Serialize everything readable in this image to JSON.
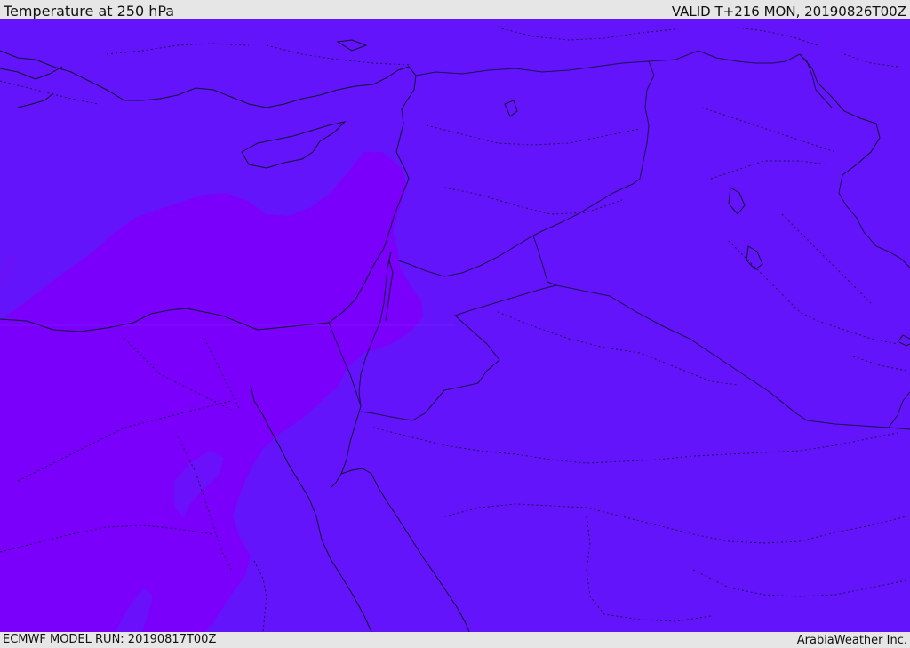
{
  "header": {
    "title": "Temperature at 250 hPa",
    "valid": "VALID T+216 MON, 20190826T00Z"
  },
  "footer": {
    "model_run": "ECMWF MODEL RUN: 20190817T00Z",
    "credit": "ArabiaWeather Inc."
  },
  "colors": {
    "field_base": "#6414fa",
    "field_warm": "#7a00fb",
    "field_warm_edge": "#7006fa",
    "coastline": "#111133",
    "border": "#1a1050",
    "panel": "#e6e6e6"
  }
}
